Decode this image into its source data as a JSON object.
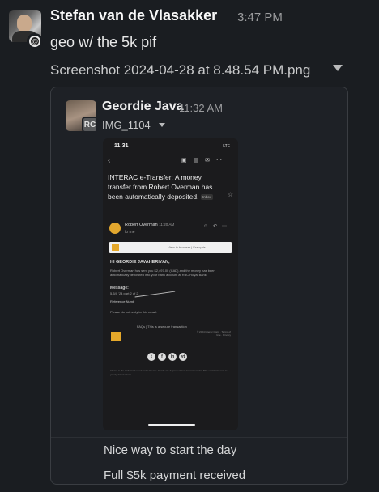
{
  "message": {
    "author": "Stefan van de Vlasakker",
    "time": "3:47 PM",
    "text": "geo w/ the 5k pif",
    "file_title": "Screenshot 2024-04-28 at 8.48.54 PM.png",
    "status_icon": "spiral-status-icon"
  },
  "shared": {
    "author": "Geordie Java",
    "time": "11:32 AM",
    "file_name": "IMG_1104",
    "avatar_badge": "RC",
    "replies": [
      "Nice way to start the day",
      "Full $5k payment received"
    ]
  },
  "phone": {
    "time": "11:31",
    "signal": "LTE",
    "subject": "INTERAC e-Transfer: A money transfer from Robert Overman has been automatically deposited.",
    "tag": "Inbox",
    "sender": "Robert Overman",
    "sender_time": "11:20 AM",
    "to": "to me",
    "view_browser": "View in browser | Français",
    "greeting": "HI GEORDIE JAVAHERIYAN,",
    "body": "Robert Overman has sent you $2,497.00 (CAD) and the money has been automatically deposited into your bank account at RBC Royal Bank.",
    "message_label": "Message:",
    "message_text": "5-5/0 '24 part 2 of 2",
    "reference_label": "Reference Numb",
    "noreply": "Please do not reply to this email.",
    "faq": "FAQs  |  This is a secure transaction",
    "fine": "© 2024 Interac Corp. · Terms of Use · Privacy",
    "social": [
      "t",
      "f",
      "in",
      "yt"
    ],
    "footer": "Interac is the trademark used under license. Funds are deposited from Interac sender. This email was sent to you by Interac Corp."
  }
}
